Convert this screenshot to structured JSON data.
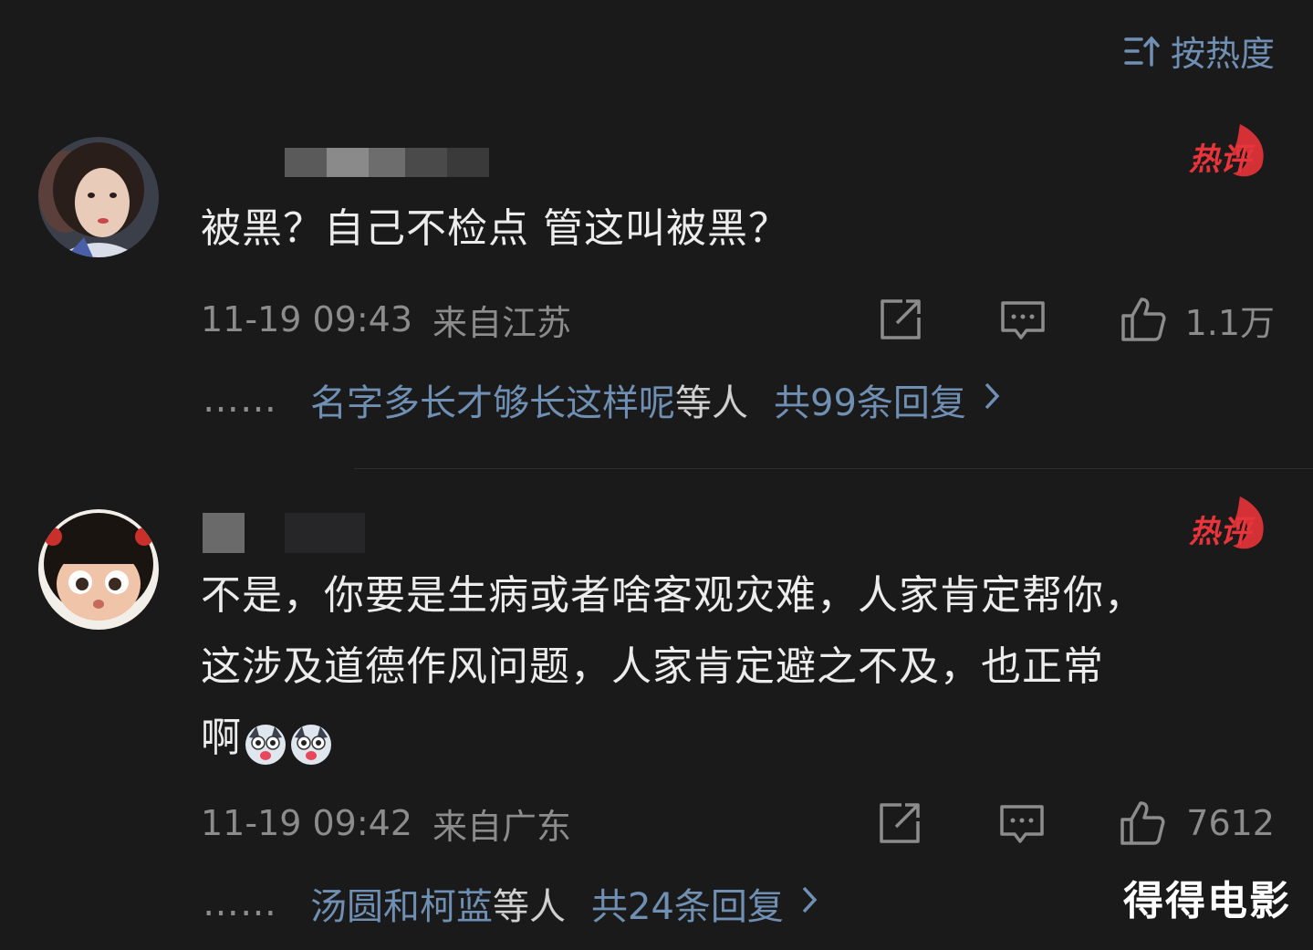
{
  "sort": {
    "label": "按热度"
  },
  "comments": [
    {
      "text": "被黑？自己不检点 管这叫被黑？",
      "hot_badge": "热评",
      "time": "11-19 09:43",
      "location": "来自江苏",
      "likes": "1.1万",
      "replies": {
        "dots": "……",
        "names": "名字多长才够长这样呢",
        "deng": "等人",
        "total": "共99条回复"
      }
    },
    {
      "text_lines": [
        "不是，你要是生病或者啥客观灾难，人家肯定帮你，",
        "这涉及道德作风问题，人家肯定避之不及，也正常",
        "啊"
      ],
      "hot_badge": "热评",
      "time": "11-19 09:42",
      "location": "来自广东",
      "likes": "7612",
      "replies": {
        "dots": "……",
        "names": "汤圆和柯蓝",
        "deng": "等人",
        "total": "共24条回复"
      }
    }
  ],
  "watermark": "得得电影",
  "colors": {
    "background": "#1a1a1b",
    "link": "#6f8fb3",
    "meta": "#8c8c8c",
    "hot_badge": "#e8343a"
  },
  "icons": [
    "sort-icon",
    "hot-comment-badge",
    "share-icon",
    "comment-icon",
    "like-icon",
    "chevron-right-icon",
    "emoji-dog-icon"
  ]
}
